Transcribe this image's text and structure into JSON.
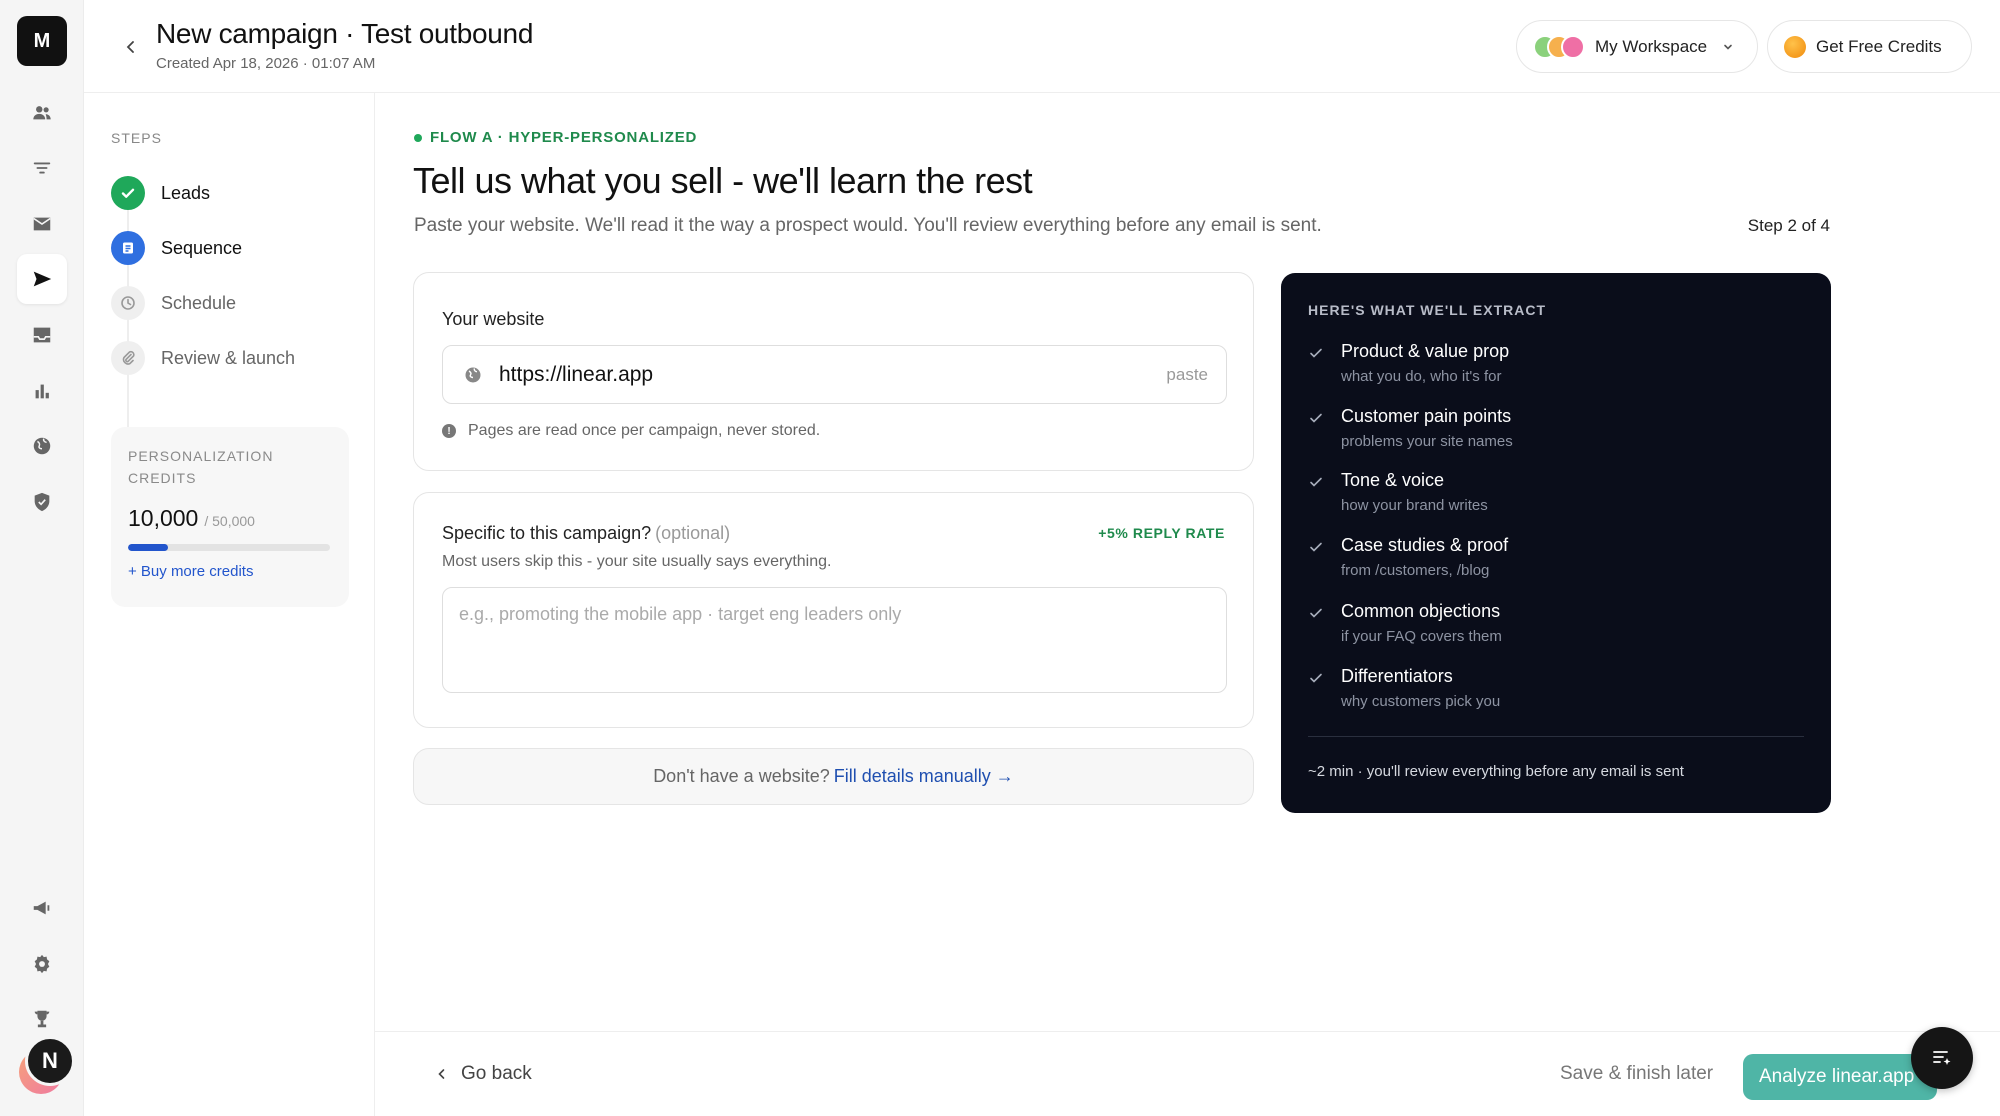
{
  "rail": {
    "logo_letter": "M",
    "avatar_letter": "N",
    "icons": [
      "users-icon",
      "filter-icon",
      "mail-icon",
      "send-icon",
      "inbox-icon",
      "bar-chart-icon",
      "globe-icon",
      "shield-icon",
      "megaphone-icon",
      "settings-icon",
      "trophy-icon"
    ],
    "active_icon": "send-icon"
  },
  "header": {
    "title": "New campaign · Test outbound",
    "created": "Created Apr 18, 2026 · 01:07 AM",
    "workspace_label": "My Workspace",
    "credits_button": "Get Free Credits"
  },
  "steps": {
    "heading": "STEPS",
    "items": [
      {
        "label": "Leads",
        "state": "done"
      },
      {
        "label": "Sequence",
        "state": "current"
      },
      {
        "label": "Schedule",
        "state": "todo"
      },
      {
        "label": "Review & launch",
        "state": "todo"
      }
    ]
  },
  "credits": {
    "title": "PERSONALIZATION CREDITS",
    "value": "10,000",
    "total": "/ 50,000",
    "fraction_used": 0.2,
    "link": "+ Buy more credits"
  },
  "main": {
    "flow_tag": "FLOW A · HYPER-PERSONALIZED",
    "title": "Tell us what you sell - we'll learn the rest",
    "subtitle": "Paste your website. We'll read it the way a prospect would. You'll review everything before any email is sent.",
    "step_counter": "Step 2 of 4",
    "website": {
      "label": "Your website",
      "url": "https://linear.app",
      "paste_hint": "paste",
      "note": "Pages are read once per campaign, never stored."
    },
    "specific": {
      "title": "Specific to this campaign?",
      "optional": "(optional)",
      "badge": "+5% REPLY RATE",
      "subtitle": "Most users skip this - your site usually says everything.",
      "placeholder": "e.g., promoting the mobile app · target eng leaders only"
    },
    "manual": {
      "prompt": "Don't have a website?",
      "link": "Fill details manually →"
    }
  },
  "extract": {
    "heading": "HERE'S WHAT WE'LL EXTRACT",
    "items": [
      {
        "title": "Product & value prop",
        "desc": "what you do, who it's for"
      },
      {
        "title": "Customer pain points",
        "desc": "problems your site names"
      },
      {
        "title": "Tone & voice",
        "desc": "how your brand writes"
      },
      {
        "title": "Case studies & proof",
        "desc": "from /customers, /blog"
      },
      {
        "title": "Common objections",
        "desc": "if your FAQ covers them"
      },
      {
        "title": "Differentiators",
        "desc": "why customers pick you"
      }
    ],
    "footer": "~2 min · you'll review everything before any email is sent"
  },
  "footer": {
    "go_back": "Go back",
    "save_later": "Save & finish later",
    "analyze": "Analyze linear.app"
  },
  "colors": {
    "accent_green": "#1fa85a",
    "accent_blue": "#2f6fe0",
    "link_blue": "#1f4fb0",
    "dark_panel": "#0a0d1a",
    "analyze_button": "#4fb5a6"
  }
}
